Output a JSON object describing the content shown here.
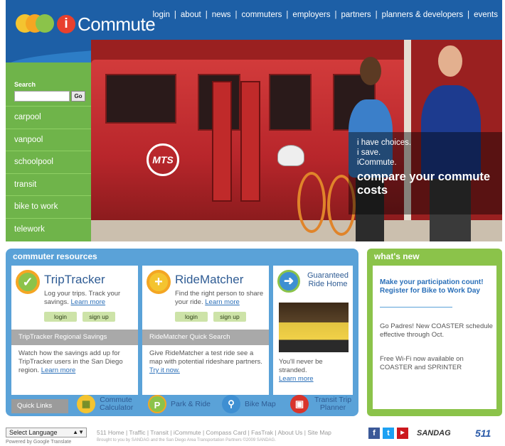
{
  "brand": {
    "name": "Commute",
    "mark": "i"
  },
  "topnav": [
    "login",
    "about",
    "news",
    "commuters",
    "employers",
    "partners",
    "planners & developers",
    "events"
  ],
  "sidebar": {
    "search_label": "Search",
    "go_label": "Go",
    "items": [
      "carpool",
      "vanpool",
      "schoolpool",
      "transit",
      "bike to work",
      "telework"
    ]
  },
  "hero": {
    "tram_logo": "MTS",
    "lines": [
      "i have choices.",
      "i save.",
      "iCommute."
    ],
    "headline": "compare your commute costs"
  },
  "resources": {
    "title": "commuter resources",
    "triptracker": {
      "name": "TripTracker",
      "desc": "Log your trips. Track your savings.",
      "link": "Learn more",
      "login": "login",
      "signup": "sign up",
      "sub_title": "TripTracker Regional Savings",
      "sub_desc": "Watch how the savings add up for TripTracker users in the San Diego region.",
      "sub_link": "Learn more"
    },
    "ridematcher": {
      "name": "RideMatcher",
      "desc": "Find the right person to share your ride.",
      "link": "Learn more",
      "login": "login",
      "signup": "sign up",
      "sub_title": "RideMatcher Quick Search",
      "sub_desc": "Give RideMatcher a test ride see a map with potential rideshare partners.",
      "sub_link": "Try it now."
    },
    "grh": {
      "name": "Guaranteed Ride Home",
      "desc": "You'll never be stranded.",
      "link": "Learn more"
    },
    "quick_links": {
      "label": "Quick Links",
      "items": [
        {
          "label": "Commute Calculator",
          "icon": "calculator-icon"
        },
        {
          "label": "Park & Ride",
          "icon": "parking-icon"
        },
        {
          "label": "Bike Map",
          "icon": "bike-icon"
        },
        {
          "label": "Transit Trip Planner",
          "icon": "bus-icon"
        }
      ]
    }
  },
  "whats_new": {
    "title": "what's new",
    "headline": "Make your participation count! Register for Bike to Work Day",
    "items": [
      "Go Padres! New COASTER schedule effective through Oct.",
      "Free Wi-Fi now available on COASTER and SPRINTER"
    ]
  },
  "footer": {
    "language_select": "Select Language",
    "powered_by": "Powered by Google Translate",
    "links": "511 Home | Traffic | Transit | iCommute | Compass Card | FasTrak | About Us | Site Map",
    "credit": "Brought to you by SANDAG and the San Diego Area Transportation Partners ©2009 SANDAG.",
    "sandag": "SANDAG",
    "five11": "511"
  },
  "colors": {
    "header_blue": "#1d5fa6",
    "sidebar_green": "#6fb44a",
    "resource_blue": "#5aa2d8",
    "news_green": "#8bc34a"
  }
}
